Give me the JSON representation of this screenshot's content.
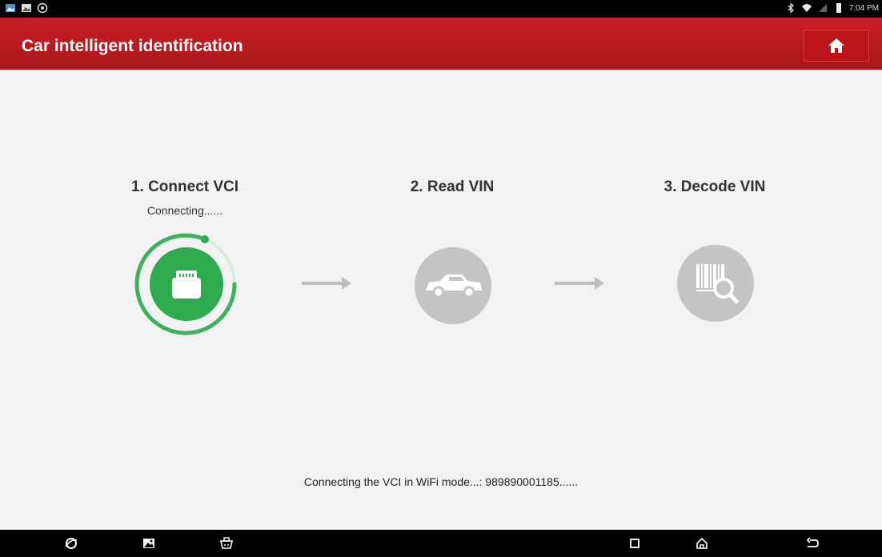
{
  "status_bar": {
    "time": "7:04 PM"
  },
  "app_bar": {
    "title": "Car intelligent identification"
  },
  "steps": [
    {
      "title": "1. Connect VCI",
      "subtitle": "Connecting......",
      "icon": "vci-connector-icon",
      "state": "active"
    },
    {
      "title": "2. Read VIN",
      "icon": "car-icon",
      "state": "pending"
    },
    {
      "title": "3. Decode VIN",
      "icon": "barcode-search-icon",
      "state": "pending"
    }
  ],
  "message": "Connecting the VCI in WiFi mode...: 989890001185......",
  "colors": {
    "accent": "#c81f25",
    "active_green": "#2eaa4f",
    "pending_gray": "#c4c4c4"
  }
}
